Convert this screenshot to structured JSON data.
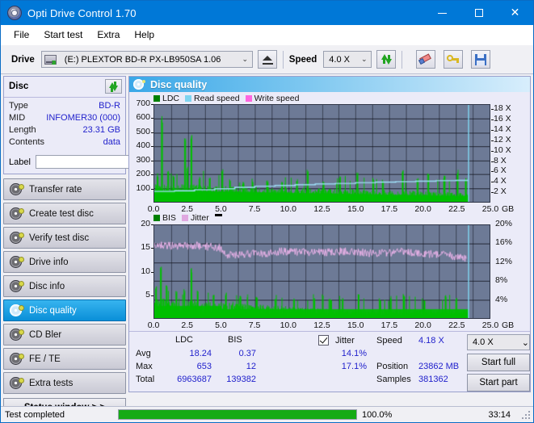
{
  "window": {
    "title": "Opti Drive Control 1.70",
    "icon": "disc-icon",
    "minimize": "—",
    "maximize": "□",
    "close": "✕"
  },
  "menu": {
    "items": [
      {
        "label": "File"
      },
      {
        "label": "Start test"
      },
      {
        "label": "Extra"
      },
      {
        "label": "Help"
      }
    ]
  },
  "toolbar": {
    "drive_label": "Drive",
    "drive_value": "(E:)   PLEXTOR BD-R  PX-LB950SA 1.06",
    "speed_label": "Speed",
    "speed_value": "4.0 X",
    "eject_icon": "eject-icon",
    "refresh_icon": "refresh-icon",
    "erase_icon": "eraser-icon",
    "key_icon": "key-icon",
    "save_icon": "save-icon",
    "chevron": "⌄"
  },
  "sidebar": {
    "disc_panel": {
      "title": "Disc",
      "refresh_icon": "refresh-icon",
      "rows": [
        {
          "key": "Type",
          "value": "BD-R"
        },
        {
          "key": "MID",
          "value": "INFOMER30 (000)"
        },
        {
          "key": "Length",
          "value": "23.31 GB"
        },
        {
          "key": "Contents",
          "value": "data"
        }
      ],
      "label_key": "Label",
      "label_value": "",
      "label_placeholder": "",
      "cd_icon": "cd-icon"
    },
    "nav_items": [
      {
        "label": "Transfer rate",
        "active": false
      },
      {
        "label": "Create test disc",
        "active": false
      },
      {
        "label": "Verify test disc",
        "active": false
      },
      {
        "label": "Drive info",
        "active": false
      },
      {
        "label": "Disc info",
        "active": false
      },
      {
        "label": "Disc quality",
        "active": true
      },
      {
        "label": "CD Bler",
        "active": false
      },
      {
        "label": "FE / TE",
        "active": false
      },
      {
        "label": "Extra tests",
        "active": false
      }
    ],
    "status_window_button": "Status window > >"
  },
  "main": {
    "title": "Disc quality",
    "title_icon": "disc-quality-icon"
  },
  "chart_data": [
    {
      "type": "line",
      "id": "ldc-chart",
      "title": "Disc quality",
      "legend": [
        {
          "label": "LDC",
          "color": "#008000"
        },
        {
          "label": "Read speed",
          "color": "#7fd4f0"
        },
        {
          "label": "Write speed",
          "color": "#ff66e0"
        }
      ],
      "legend_position": "top-left",
      "xlabel": "GB",
      "x_ticks": [
        "0.0",
        "2.5",
        "5.0",
        "7.5",
        "10.0",
        "12.5",
        "15.0",
        "17.5",
        "20.0",
        "22.5",
        "25.0"
      ],
      "xlim": [
        0,
        25
      ],
      "ylabel_left": "",
      "y_ticks_left": [
        "700",
        "600",
        "500",
        "400",
        "300",
        "200",
        "100"
      ],
      "ylim_left": [
        0,
        700
      ],
      "y_ticks_right": [
        "18 X",
        "16 X",
        "14 X",
        "12 X",
        "10 X",
        "8 X",
        "6 X",
        "4 X",
        "2 X"
      ],
      "ylim_right": [
        0,
        19
      ],
      "grid": true,
      "plot_bg": "#6d7a96",
      "series": [
        {
          "name": "LDC",
          "color": "#00c000",
          "kind": "area-spikes",
          "x_end_gb": 23.4,
          "baseline": 95,
          "peaks": [
            {
              "x": 0.55,
              "y": 655
            },
            {
              "x": 2.25,
              "y": 470
            },
            {
              "x": 2.75,
              "y": 508
            },
            {
              "x": 0.2,
              "y": 210
            },
            {
              "x": 1.0,
              "y": 230
            },
            {
              "x": 1.4,
              "y": 200
            },
            {
              "x": 2.45,
              "y": 255
            },
            {
              "x": 3.35,
              "y": 185
            },
            {
              "x": 4.1,
              "y": 175
            },
            {
              "x": 5.05,
              "y": 250
            },
            {
              "x": 5.6,
              "y": 165
            },
            {
              "x": 6.6,
              "y": 150
            },
            {
              "x": 7.3,
              "y": 160
            },
            {
              "x": 8.4,
              "y": 155
            },
            {
              "x": 9.5,
              "y": 145
            },
            {
              "x": 10.6,
              "y": 170
            },
            {
              "x": 11.4,
              "y": 245
            },
            {
              "x": 12.6,
              "y": 150
            },
            {
              "x": 13.8,
              "y": 190
            },
            {
              "x": 15.1,
              "y": 225
            },
            {
              "x": 16.3,
              "y": 180
            },
            {
              "x": 17.0,
              "y": 165
            },
            {
              "x": 18.5,
              "y": 230
            },
            {
              "x": 19.6,
              "y": 175
            },
            {
              "x": 20.4,
              "y": 210
            },
            {
              "x": 21.6,
              "y": 195
            },
            {
              "x": 22.6,
              "y": 235
            },
            {
              "x": 23.2,
              "y": 185
            }
          ]
        },
        {
          "name": "Read speed",
          "color": "#9fe0f8",
          "kind": "step-line",
          "axis": "right",
          "points": [
            {
              "x": 0.0,
              "y": 2.05
            },
            {
              "x": 1.5,
              "y": 2.15
            },
            {
              "x": 3.0,
              "y": 2.35
            },
            {
              "x": 4.5,
              "y": 2.55
            },
            {
              "x": 6.0,
              "y": 2.85
            },
            {
              "x": 7.5,
              "y": 3.05
            },
            {
              "x": 9.0,
              "y": 3.2
            },
            {
              "x": 10.5,
              "y": 3.35
            },
            {
              "x": 12.0,
              "y": 3.5
            },
            {
              "x": 13.5,
              "y": 3.6
            },
            {
              "x": 15.0,
              "y": 3.75
            },
            {
              "x": 16.5,
              "y": 3.85
            },
            {
              "x": 18.0,
              "y": 3.95
            },
            {
              "x": 19.5,
              "y": 4.05
            },
            {
              "x": 21.0,
              "y": 4.15
            },
            {
              "x": 22.5,
              "y": 4.2
            },
            {
              "x": 23.4,
              "y": 4.25
            }
          ],
          "end_marker": {
            "x": 23.4,
            "y_top": 19.0
          }
        }
      ]
    },
    {
      "type": "line",
      "id": "bis-jitter-chart",
      "legend": [
        {
          "label": "BIS",
          "color": "#008000"
        },
        {
          "label": "Jitter",
          "color": "#e0a8e0"
        },
        {
          "label": "",
          "color": "#000000"
        }
      ],
      "legend_position": "top-left",
      "xlabel": "GB",
      "x_ticks": [
        "0.0",
        "2.5",
        "5.0",
        "7.5",
        "10.0",
        "12.5",
        "15.0",
        "17.5",
        "20.0",
        "22.5",
        "25.0"
      ],
      "xlim": [
        0,
        25
      ],
      "y_ticks_left": [
        "20",
        "15",
        "10",
        "5"
      ],
      "ylim_left": [
        0,
        20
      ],
      "y_ticks_right": [
        "20%",
        "16%",
        "12%",
        "8%",
        "4%"
      ],
      "ylim_right": [
        0,
        20
      ],
      "grid": true,
      "plot_bg": "#6d7a96",
      "series": [
        {
          "name": "BIS",
          "color": "#00c000",
          "kind": "area-spikes",
          "x_end_gb": 23.4,
          "baseline": 3.2,
          "peaks": [
            {
              "x": 0.45,
              "y": 12.2
            },
            {
              "x": 2.75,
              "y": 11.1
            },
            {
              "x": 0.1,
              "y": 7.0
            },
            {
              "x": 0.9,
              "y": 7.6
            },
            {
              "x": 1.6,
              "y": 6.0
            },
            {
              "x": 2.2,
              "y": 6.4
            },
            {
              "x": 3.2,
              "y": 6.0
            },
            {
              "x": 4.4,
              "y": 5.5
            },
            {
              "x": 5.3,
              "y": 5.5
            },
            {
              "x": 6.4,
              "y": 4.8
            },
            {
              "x": 7.6,
              "y": 4.6
            },
            {
              "x": 9.0,
              "y": 4.2
            },
            {
              "x": 10.4,
              "y": 4.5
            },
            {
              "x": 11.9,
              "y": 4.3
            },
            {
              "x": 13.1,
              "y": 4.6
            },
            {
              "x": 14.0,
              "y": 4.4
            },
            {
              "x": 15.2,
              "y": 5.2
            },
            {
              "x": 16.8,
              "y": 4.4
            },
            {
              "x": 17.6,
              "y": 4.8
            },
            {
              "x": 18.6,
              "y": 5.4
            },
            {
              "x": 20.1,
              "y": 4.3
            },
            {
              "x": 21.7,
              "y": 5.0
            },
            {
              "x": 22.5,
              "y": 4.4
            }
          ]
        },
        {
          "name": "Jitter",
          "color": "#e6b0e6",
          "kind": "noisy-line",
          "x_end_gb": 23.3,
          "points": [
            {
              "x": 0.0,
              "y": 16.0
            },
            {
              "x": 1.0,
              "y": 15.6
            },
            {
              "x": 2.0,
              "y": 15.6
            },
            {
              "x": 3.0,
              "y": 15.7
            },
            {
              "x": 4.0,
              "y": 15.4
            },
            {
              "x": 5.0,
              "y": 15.1
            },
            {
              "x": 5.4,
              "y": 13.6
            },
            {
              "x": 6.5,
              "y": 13.7
            },
            {
              "x": 7.5,
              "y": 14.0
            },
            {
              "x": 8.5,
              "y": 13.9
            },
            {
              "x": 9.5,
              "y": 14.4
            },
            {
              "x": 10.5,
              "y": 14.2
            },
            {
              "x": 11.5,
              "y": 14.2
            },
            {
              "x": 12.5,
              "y": 14.1
            },
            {
              "x": 13.5,
              "y": 14.3
            },
            {
              "x": 14.5,
              "y": 14.4
            },
            {
              "x": 15.5,
              "y": 14.1
            },
            {
              "x": 16.5,
              "y": 13.9
            },
            {
              "x": 17.5,
              "y": 14.1
            },
            {
              "x": 18.5,
              "y": 14.3
            },
            {
              "x": 19.5,
              "y": 13.9
            },
            {
              "x": 20.5,
              "y": 13.8
            },
            {
              "x": 21.5,
              "y": 13.6
            },
            {
              "x": 22.5,
              "y": 13.3
            },
            {
              "x": 23.3,
              "y": 13.0
            }
          ]
        }
      ]
    }
  ],
  "stats": {
    "col_headers": [
      "LDC",
      "BIS"
    ],
    "row_labels": [
      "Avg",
      "Max",
      "Total"
    ],
    "ldc": {
      "avg": "18.24",
      "max": "653",
      "total": "6963687"
    },
    "bis": {
      "avg": "0.37",
      "max": "12",
      "total": "139382"
    },
    "jitter": {
      "checkbox_label": "Jitter",
      "checked": true,
      "avg": "14.1%",
      "max": "17.1%"
    },
    "speed_label": "Speed",
    "speed_value": "4.18 X",
    "position_label": "Position",
    "position_value": "23862 MB",
    "samples_label": "Samples",
    "samples_value": "381362",
    "speed_select": "4.0 X",
    "speed_select_chevron": "⌄",
    "start_full_button": "Start full",
    "start_part_button": "Start part"
  },
  "statusbar": {
    "message": "Test completed",
    "progress_percent": "100.0%",
    "progress_value": 100,
    "elapsed": "33:14"
  }
}
